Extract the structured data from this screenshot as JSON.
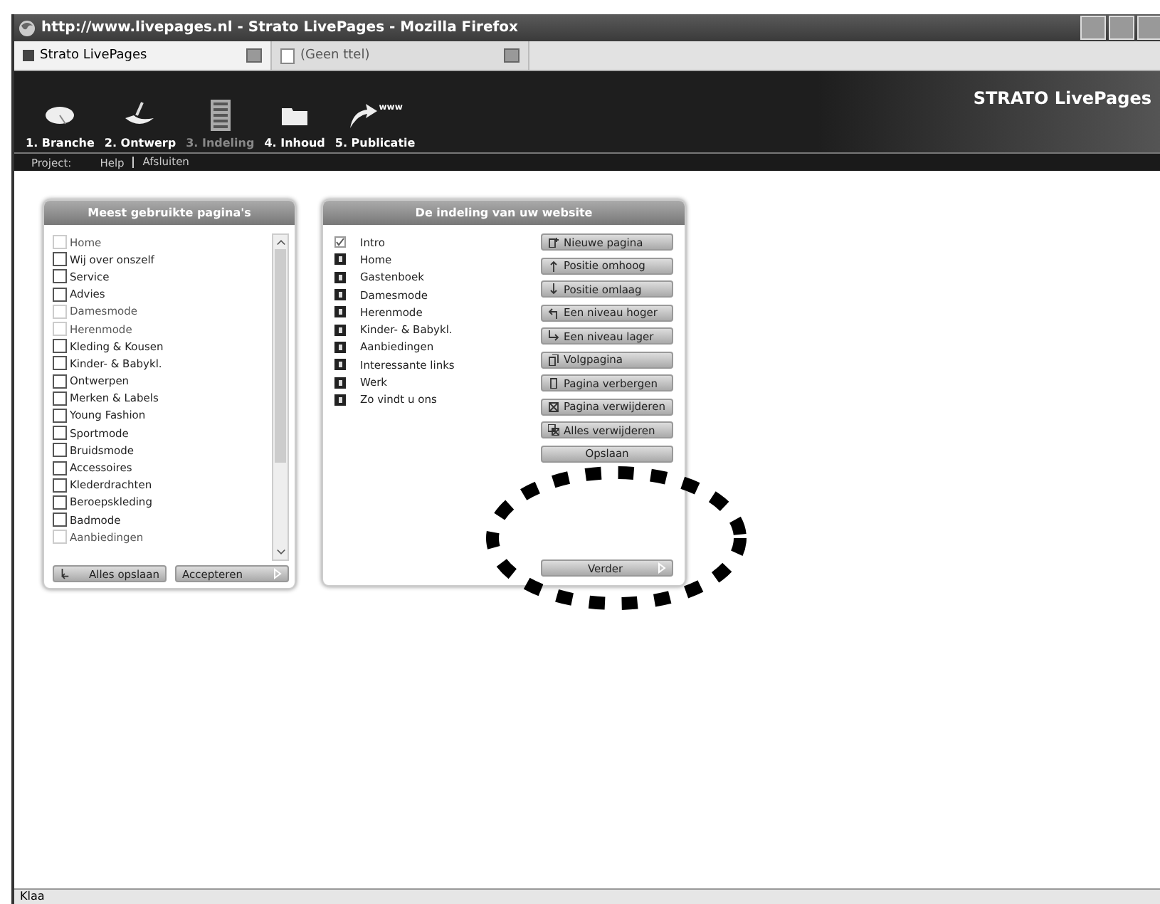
{
  "window": {
    "title": "http://www.livepages.nl - Strato LivePages - Mozilla Firefox"
  },
  "tabs": [
    {
      "label": "Strato LivePages",
      "selected": true
    },
    {
      "label": "(Geen ttel)",
      "selected": false
    }
  ],
  "header": {
    "brand": "STRATO LivePages",
    "steps": [
      {
        "label": "1. Branche",
        "selected": false
      },
      {
        "label": "2. Ontwerp",
        "selected": false
      },
      {
        "label": "3. Indeling",
        "selected": true
      },
      {
        "label": "4. Inhoud",
        "selected": false
      },
      {
        "label": "5. Publicatie",
        "selected": false
      }
    ],
    "arrow_caption": "www",
    "menu": [
      "Project:",
      "Help",
      "Afsluiten"
    ]
  },
  "pages_panel": {
    "title": "Meest gebruikte pagina's",
    "items": [
      {
        "label": "Home",
        "checked": false,
        "disabled": true
      },
      {
        "label": "Wij over onszelf",
        "checked": false,
        "disabled": false
      },
      {
        "label": "Service",
        "checked": false,
        "disabled": false
      },
      {
        "label": "Advies",
        "checked": false,
        "disabled": false
      },
      {
        "label": "Damesmode",
        "checked": false,
        "disabled": true
      },
      {
        "label": "Herenmode",
        "checked": false,
        "disabled": true
      },
      {
        "label": "Kleding & Kousen",
        "checked": false,
        "disabled": false
      },
      {
        "label": "Kinder- & Babykl.",
        "checked": false,
        "disabled": false
      },
      {
        "label": "Ontwerpen",
        "checked": false,
        "disabled": false
      },
      {
        "label": "Merken & Labels",
        "checked": false,
        "disabled": false
      },
      {
        "label": "Young Fashion",
        "checked": false,
        "disabled": false
      },
      {
        "label": "Sportmode",
        "checked": false,
        "disabled": false
      },
      {
        "label": "Bruidsmode",
        "checked": false,
        "disabled": false
      },
      {
        "label": "Accessoires",
        "checked": false,
        "disabled": false
      },
      {
        "label": "Klederdrachten",
        "checked": false,
        "disabled": false
      },
      {
        "label": "Beroepskleding",
        "checked": false,
        "disabled": false
      },
      {
        "label": "Badmode",
        "checked": false,
        "disabled": false
      },
      {
        "label": "Aanbiedingen",
        "checked": false,
        "disabled": true
      }
    ],
    "buttons": [
      "Alles opslaan",
      "Accepteren"
    ]
  },
  "layout_panel": {
    "title": "De indeling van uw website",
    "items": [
      {
        "label": "Intro",
        "kind": "checked"
      },
      {
        "label": "Home",
        "kind": "page"
      },
      {
        "label": "Gastenboek",
        "kind": "page"
      },
      {
        "label": "Damesmode",
        "kind": "page"
      },
      {
        "label": "Herenmode",
        "kind": "page"
      },
      {
        "label": "Kinder- & Babykl.",
        "kind": "page"
      },
      {
        "label": "Aanbiedingen",
        "kind": "page"
      },
      {
        "label": "Interessante links",
        "kind": "page"
      },
      {
        "label": "Werk",
        "kind": "page"
      },
      {
        "label": "Zo vindt u ons",
        "kind": "page"
      }
    ],
    "actions": [
      "Nieuwe pagina",
      "Positie omhoog",
      "Positie omlaag",
      "Een niveau hoger",
      "Een niveau lager",
      "Volgpagina",
      "Pagina verbergen",
      "Pagina verwijderen",
      "Alles verwijderen",
      "Opslaan"
    ],
    "next_button": "Verder"
  },
  "status_bar": "Klaa"
}
